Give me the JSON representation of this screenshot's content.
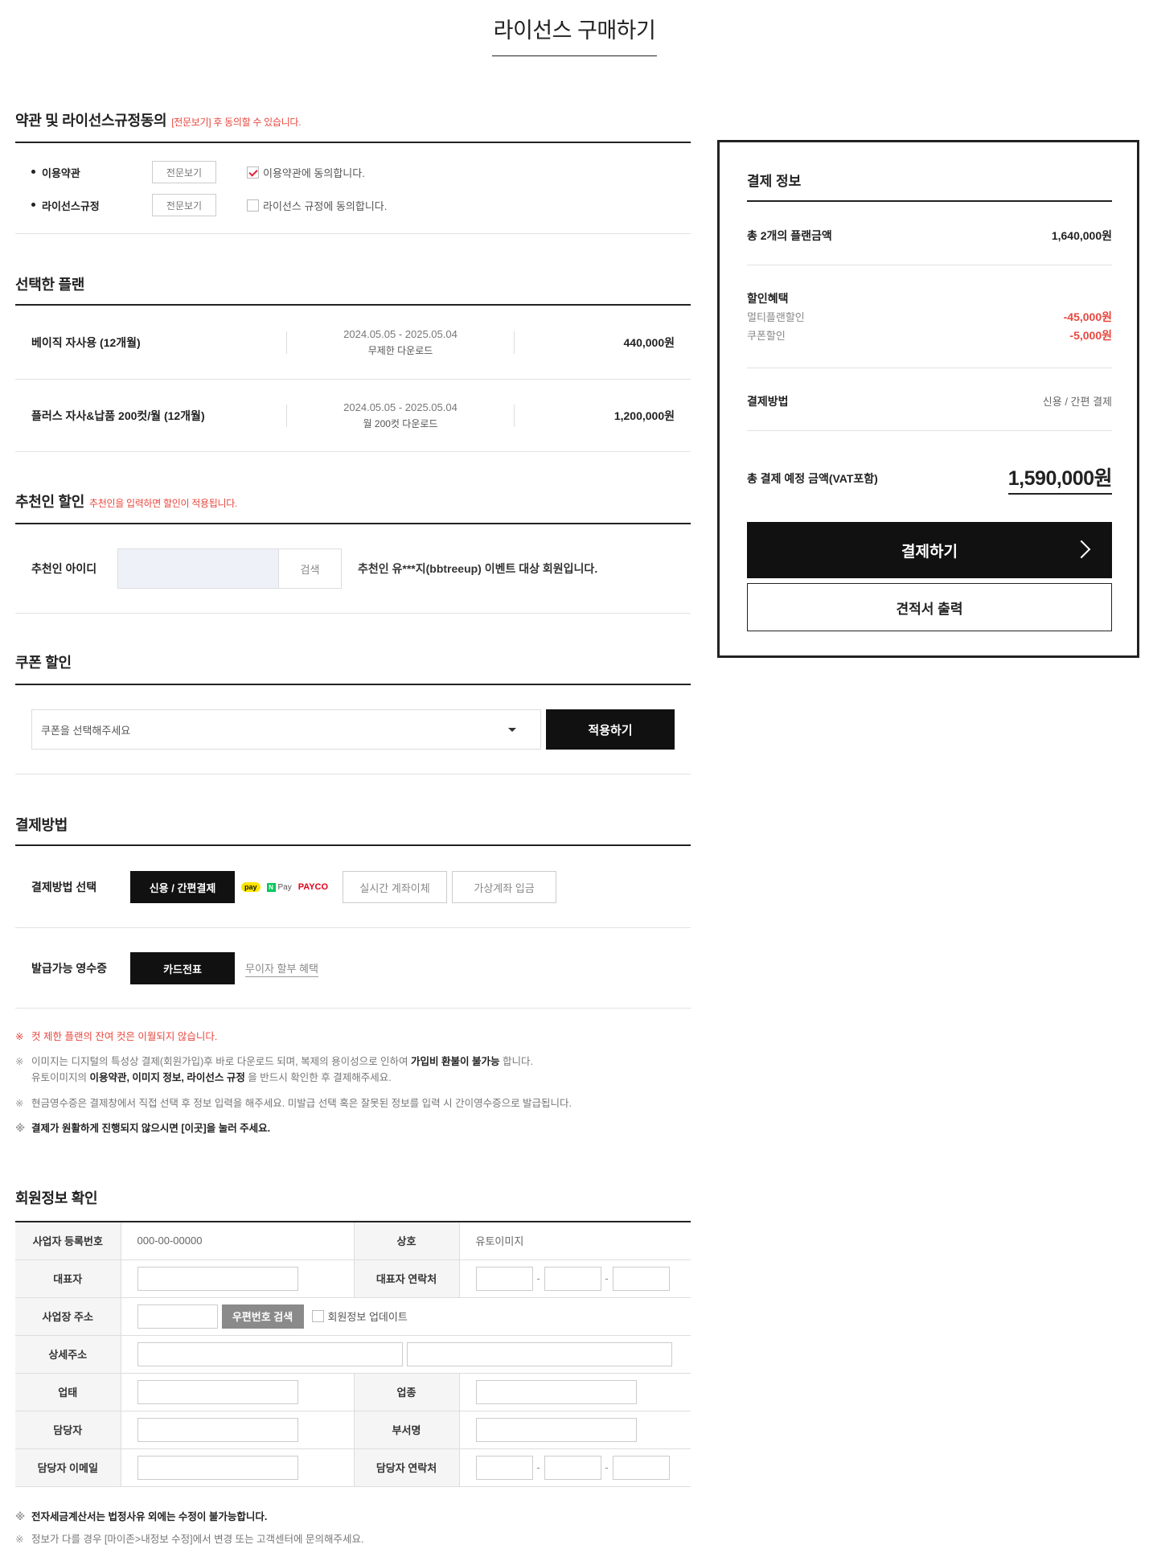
{
  "page_title": "라이선스 구매하기",
  "terms": {
    "title": "약관 및 라이선스규정동의",
    "note": "[전문보기] 후 동의할 수 있습니다.",
    "rows": [
      {
        "label": "이용약관",
        "button": "전문보기",
        "check_label": "이용약관에 동의합니다.",
        "checked": true
      },
      {
        "label": "라이선스규정",
        "button": "전문보기",
        "check_label": "라이선스 규정에 동의합니다.",
        "checked": false
      }
    ]
  },
  "plans": {
    "title": "선택한 플랜",
    "items": [
      {
        "name": "베이직 자사용 (12개월)",
        "period": "2024.05.05 - 2025.05.04",
        "desc": "무제한 다운로드",
        "price": "440,000원"
      },
      {
        "name": "플러스 자사&납품 200컷/월 (12개월)",
        "period": "2024.05.05 - 2025.05.04",
        "desc": "월 200컷 다운로드",
        "price": "1,200,000원"
      }
    ]
  },
  "referral": {
    "title": "추천인 할인",
    "note": "추천인을 입력하면 할인이 적용됩니다.",
    "label": "추천인 아이디",
    "input_value": "",
    "search_label": "검색",
    "message": "추천인 유***지(bbtreeup) 이벤트 대상 회원입니다."
  },
  "coupon": {
    "title": "쿠폰 할인",
    "selected": "쿠폰을 선택해주세요",
    "apply_label": "적용하기"
  },
  "payment": {
    "title": "결제방법",
    "method_label": "결제방법 선택",
    "methods": [
      "신용 / 간편결제",
      "실시간 계좌이체",
      "가상계좌 입금"
    ],
    "logo_kakao": "pay",
    "logo_naver": "Pay",
    "logo_naver_mark": "N",
    "logo_payco": "PAYCO",
    "receipt_label": "발급가능 영수증",
    "receipt_button": "카드전표",
    "installment_link": "무이자 할부 혜택"
  },
  "notices": {
    "mark": "※",
    "n1": "컷 제한 플랜의 잔여 컷은 이월되지 않습니다.",
    "n2_a": "이미지는 디지털의 특성상 결제(회원가입)후 바로 다운로드 되며, 복제의 용이성으로 인하여 ",
    "n2_b": "가입비 환불이 불가능",
    "n2_c": " 합니다.",
    "n2_d": "유토이미지의 ",
    "n2_e": "이용약관, 이미지 정보, 라이선스 규정",
    "n2_f": " 을 반드시 확인한 후 결제해주세요.",
    "n3": "현금영수증은 결제창에서 직접 선택 후 정보 입력을 해주세요. 미발급 선택 혹은 잘못된 정보를 입력 시 간이영수증으로 발급됩니다.",
    "n4": "결제가 원활하게 진행되지 않으시면 [이곳]을 눌러 주세요."
  },
  "member": {
    "title": "회원정보 확인",
    "biz_no_label": "사업자 등록번호",
    "biz_no_value": "000-00-00000",
    "company_label": "상호",
    "company_value": "유토이미지",
    "ceo_label": "대표자",
    "ceo_phone_label": "대표자 연락처",
    "address_label": "사업장 주소",
    "zip_button": "우편번호 검색",
    "update_label": "회원정보 업데이트",
    "detail_address_label": "상세주소",
    "biz_type_label": "업태",
    "biz_item_label": "업종",
    "manager_label": "담당자",
    "dept_label": "부서명",
    "manager_email_label": "담당자 이메일",
    "manager_phone_label": "담당자 연락처",
    "dash": "-"
  },
  "footer_notices": {
    "f1": "전자세금계산서는 법정사유 외에는 수정이 불가능합니다.",
    "f2": "정보가 다를 경우 [마이존>내정보 수정]에서 변경 또는 고객센터에 문의해주세요."
  },
  "summary": {
    "title": "결제 정보",
    "plan_total_label": "총 2개의 플랜금액",
    "plan_total_value": "1,640,000원",
    "discount_label": "할인혜택",
    "multi_discount_label": "멀티플랜할인",
    "multi_discount_value": "-45,000원",
    "coupon_discount_label": "쿠폰할인",
    "coupon_discount_value": "-5,000원",
    "method_label": "결제방법",
    "method_value": "신용 / 간편 결제",
    "total_label": "총 결제 예정 금액(VAT포함)",
    "total_value": "1,590,000원",
    "pay_button": "결제하기",
    "quote_button": "견적서 출력"
  },
  "colors": {
    "accent_red": "#e8473f",
    "dark": "#111111"
  }
}
